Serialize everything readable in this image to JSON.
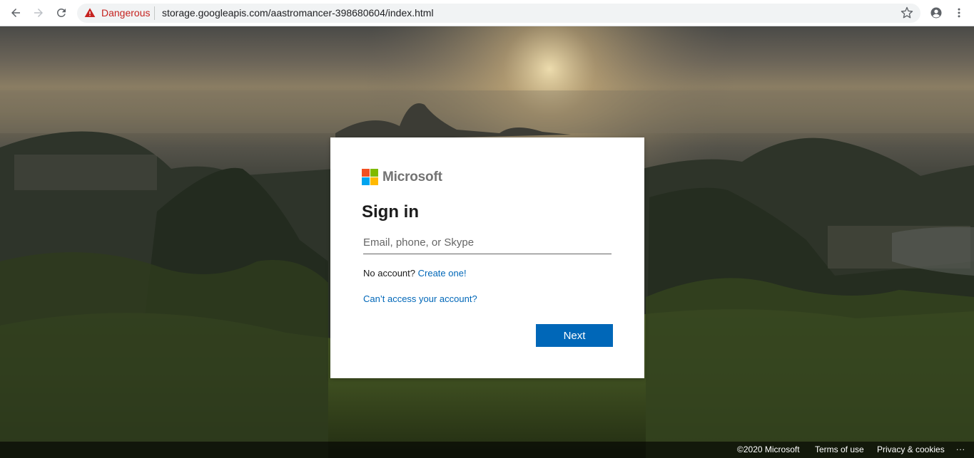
{
  "browser": {
    "security_label": "Dangerous",
    "url": "storage.googleapis.com/aastromancer-398680604/index.html",
    "colors": {
      "danger": "#c5221f",
      "omnibox": "#f1f3f4"
    },
    "icons": [
      "back-arrow-icon",
      "forward-arrow-icon",
      "reload-icon",
      "warning-triangle-icon",
      "star-icon",
      "account-icon",
      "kebab-menu-icon"
    ]
  },
  "signin": {
    "brand": "Microsoft",
    "title": "Sign in",
    "email_placeholder": "Email, phone, or Skype",
    "email_value": "",
    "no_account_text": "No account?",
    "create_link": "Create one!",
    "cant_access_link": "Can’t access your account?",
    "next_label": "Next",
    "colors": {
      "accent": "#0067b8",
      "logo_red": "#f25022",
      "logo_green": "#7fba00",
      "logo_blue": "#00a4ef",
      "logo_yellow": "#ffb900"
    }
  },
  "footer": {
    "copyright": "©2020 Microsoft",
    "terms": "Terms of use",
    "privacy": "Privacy & cookies",
    "more": "..."
  }
}
